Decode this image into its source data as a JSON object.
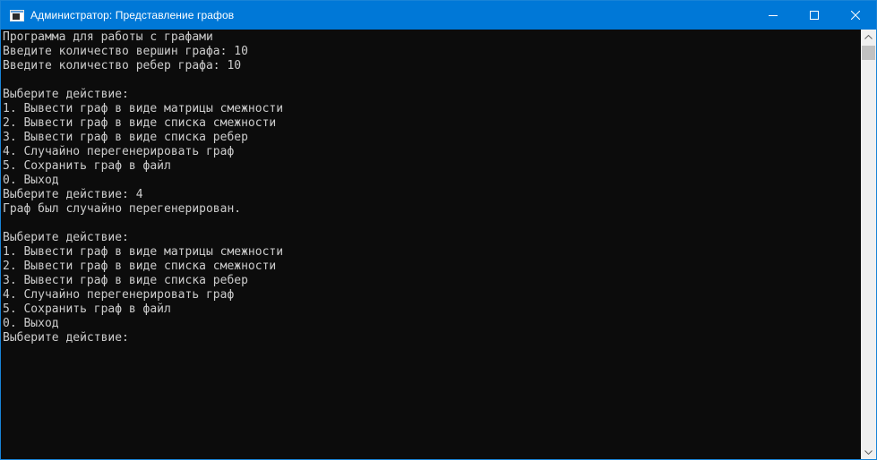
{
  "window": {
    "title": "Администратор:  Представление графов"
  },
  "controls": {
    "minimize_icon": "minimize-icon",
    "maximize_icon": "maximize-icon",
    "close_icon": "close-icon"
  },
  "console": {
    "lines": [
      "Программа для работы с графами",
      "Введите количество вершин графа: 10",
      "Введите количество ребер графа: 10",
      "",
      "Выберите действие:",
      "1. Вывести граф в виде матрицы смежности",
      "2. Вывести граф в виде списка смежности",
      "3. Вывести граф в виде списка ребер",
      "4. Случайно перегенерировать граф",
      "5. Сохранить граф в файл",
      "0. Выход",
      "Выберите действие: 4",
      "Граф был случайно перегенерирован.",
      "",
      "Выберите действие:",
      "1. Вывести граф в виде матрицы смежности",
      "2. Вывести граф в виде списка смежности",
      "3. Вывести граф в виде списка ребер",
      "4. Случайно перегенерировать граф",
      "5. Сохранить граф в файл",
      "0. Выход",
      "Выберите действие:"
    ]
  },
  "colors": {
    "titlebar": "#0078d7",
    "console_bg": "#0c0c0c",
    "console_text": "#cccccc"
  }
}
